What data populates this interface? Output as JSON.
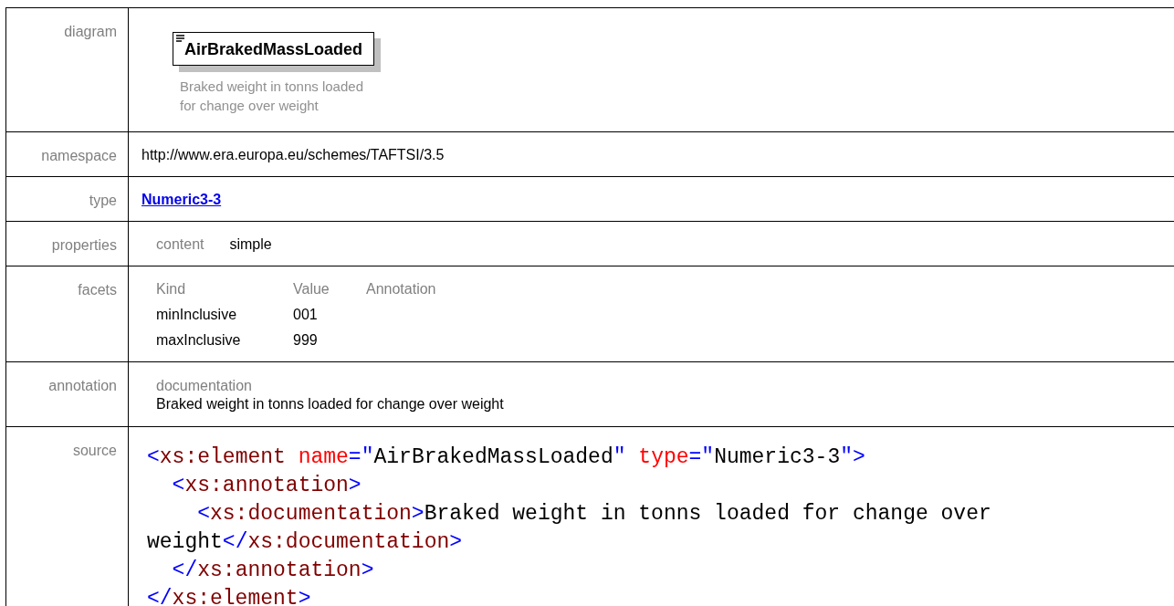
{
  "rows": [
    {
      "label": "diagram",
      "kind": "diagram",
      "element_name": "AirBrakedMassLoaded",
      "description_lines": [
        "Braked weight in tonns loaded",
        "for change over weight"
      ]
    },
    {
      "label": "namespace",
      "kind": "text",
      "value": "http://www.era.europa.eu/schemes/TAFTSI/3.5"
    },
    {
      "label": "type",
      "kind": "link",
      "value": "Numeric3-3"
    },
    {
      "label": "properties",
      "kind": "props",
      "items": [
        {
          "name": "content",
          "value": "simple"
        }
      ]
    },
    {
      "label": "facets",
      "kind": "facets",
      "columns": [
        "Kind",
        "Value",
        "Annotation"
      ],
      "facets": [
        {
          "kind": "minInclusive",
          "value": "001"
        },
        {
          "kind": "maxInclusive",
          "value": "999"
        }
      ]
    },
    {
      "label": "annotation",
      "kind": "annotation",
      "heading": "documentation",
      "text": "Braked weight in tonns loaded for change over weight"
    },
    {
      "label": "source",
      "kind": "source",
      "lines": [
        [
          {
            "kind": "bracket",
            "text": "<"
          },
          {
            "kind": "tag",
            "text": "xs:element"
          },
          {
            "kind": "attr",
            "text": " name"
          },
          {
            "kind": "bracket",
            "text": "=\""
          },
          {
            "kind": "value",
            "text": "AirBrakedMassLoaded"
          },
          {
            "kind": "bracket",
            "text": "\""
          },
          {
            "kind": "attr",
            "text": " type"
          },
          {
            "kind": "bracket",
            "text": "=\""
          },
          {
            "kind": "value",
            "text": "Numeric3-3"
          },
          {
            "kind": "bracket",
            "text": "\">"
          }
        ],
        [
          {
            "kind": "bracket",
            "text": "  <"
          },
          {
            "kind": "tag",
            "text": "xs:annotation"
          },
          {
            "kind": "bracket",
            "text": ">"
          }
        ],
        [
          {
            "kind": "bracket",
            "text": "    <"
          },
          {
            "kind": "tag",
            "text": "xs:documentation"
          },
          {
            "kind": "bracket",
            "text": ">"
          },
          {
            "kind": "text",
            "text": "Braked weight in tonns loaded for change over"
          }
        ],
        [
          {
            "kind": "text",
            "text": "weight"
          },
          {
            "kind": "bracket",
            "text": "</"
          },
          {
            "kind": "tag",
            "text": "xs:documentation"
          },
          {
            "kind": "bracket",
            "text": ">"
          }
        ],
        [
          {
            "kind": "bracket",
            "text": "  </"
          },
          {
            "kind": "tag",
            "text": "xs:annotation"
          },
          {
            "kind": "bracket",
            "text": ">"
          }
        ],
        [
          {
            "kind": "bracket",
            "text": "</"
          },
          {
            "kind": "tag",
            "text": "xs:element"
          },
          {
            "kind": "bracket",
            "text": ">"
          }
        ]
      ]
    }
  ]
}
